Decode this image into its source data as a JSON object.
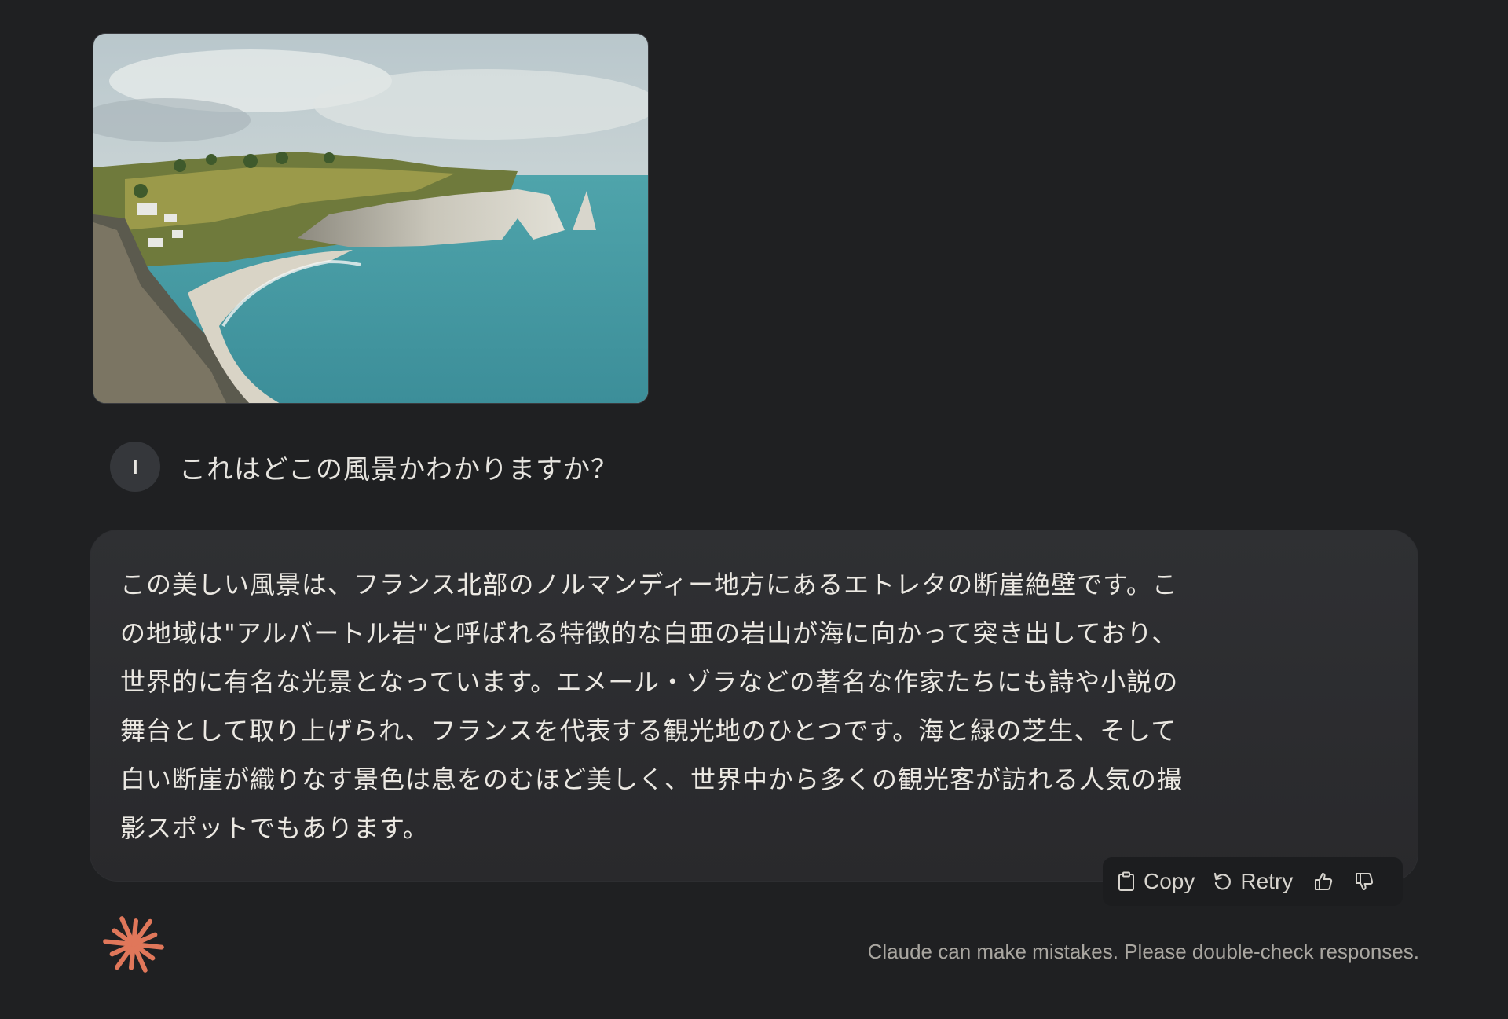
{
  "attachment": {
    "image_name": "landscape-image"
  },
  "user_message": {
    "avatar_initial": "I",
    "text": "これはどこの風景かわかりますか？"
  },
  "response": {
    "text": "この美しい風景は、フランス北部のノルマンディー地方にあるエトレタの断崖絶壁です。こ\nの地域は\"アルバートル岩\"と呼ばれる特徴的な白亜の岩山が海に向かって突き出しており、\n世界的に有名な光景となっています。エメール・ゾラなどの著名な作家たちにも詩や小説の\n舞台として取り上げられ、フランスを代表する観光地のひとつです。海と緑の芝生、そして\n白い断崖が織りなす景色は息をのむほど美しく、世界中から多くの観光客が訪れる人気の撮\n影スポットでもあります。"
  },
  "actions": {
    "copy_label": "Copy",
    "retry_label": "Retry",
    "icons": [
      "clipboard-icon",
      "retry-icon",
      "thumbs-up-icon",
      "thumbs-down-icon"
    ]
  },
  "footer": {
    "disclaimer": "Claude can make mistakes. Please double-check responses."
  },
  "colors": {
    "background": "#1f2022",
    "card": "#2f3033",
    "accent": "#e0775a",
    "text": "#ebe8e2"
  }
}
